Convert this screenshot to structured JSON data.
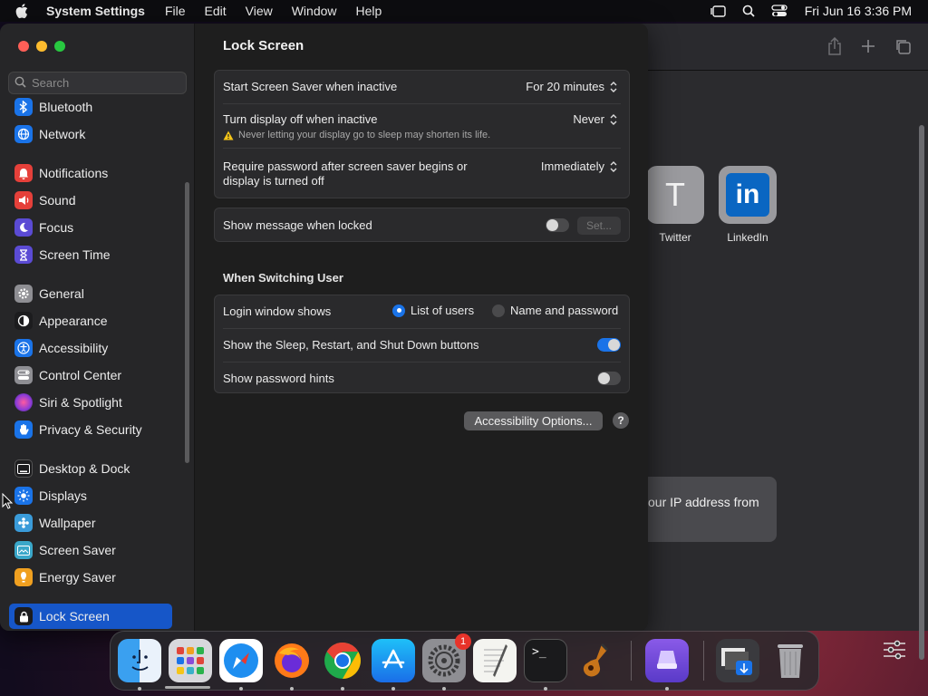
{
  "menubar": {
    "app_name": "System Settings",
    "menus": [
      "File",
      "Edit",
      "View",
      "Window",
      "Help"
    ],
    "clock": "Fri Jun 16  3:36 PM"
  },
  "search": {
    "placeholder": "Search"
  },
  "sidebar": {
    "items": [
      {
        "label": "Bluetooth",
        "icon": "bluetooth-icon",
        "color": "#1a73e8"
      },
      {
        "label": "Network",
        "icon": "network-globe-icon",
        "color": "#1a73e8"
      },
      {
        "label": "Notifications",
        "icon": "bell-icon",
        "color": "#e5403a"
      },
      {
        "label": "Sound",
        "icon": "speaker-icon",
        "color": "#e5403a"
      },
      {
        "label": "Focus",
        "icon": "moon-icon",
        "color": "#5b4bd4"
      },
      {
        "label": "Screen Time",
        "icon": "hourglass-icon",
        "color": "#5b4bd4"
      },
      {
        "label": "General",
        "icon": "gear-icon",
        "color": "#8e8e93"
      },
      {
        "label": "Appearance",
        "icon": "appearance-icon",
        "color": "#1c1c1e"
      },
      {
        "label": "Accessibility",
        "icon": "accessibility-icon",
        "color": "#1a73e8"
      },
      {
        "label": "Control Center",
        "icon": "control-center-icon",
        "color": "#8e8e93"
      },
      {
        "label": "Siri & Spotlight",
        "icon": "siri-icon",
        "color": "#c44bd4"
      },
      {
        "label": "Privacy & Security",
        "icon": "hand-icon",
        "color": "#1a73e8"
      },
      {
        "label": "Desktop & Dock",
        "icon": "dock-icon",
        "color": "#1c1c1e"
      },
      {
        "label": "Displays",
        "icon": "sun-icon",
        "color": "#1a73e8"
      },
      {
        "label": "Wallpaper",
        "icon": "wallpaper-icon",
        "color": "#3a9bd9"
      },
      {
        "label": "Screen Saver",
        "icon": "screen-saver-icon",
        "color": "#3aa7c9"
      },
      {
        "label": "Energy Saver",
        "icon": "battery-icon",
        "color": "#f0a020"
      },
      {
        "label": "Lock Screen",
        "icon": "lock-icon",
        "color": "#1c1c1e"
      }
    ]
  },
  "main": {
    "title": "Lock Screen",
    "rows": {
      "screen_saver": {
        "label": "Start Screen Saver when inactive",
        "value": "For 20 minutes"
      },
      "display_off": {
        "label": "Turn display off when inactive",
        "value": "Never",
        "warning": "Never letting your display go to sleep may shorten its life."
      },
      "require_password": {
        "label": "Require password after screen saver begins or display is turned off",
        "value": "Immediately"
      },
      "show_message": {
        "label": "Show message when locked",
        "button": "Set..."
      }
    },
    "switching": {
      "heading": "When Switching User",
      "login_window": {
        "label": "Login window shows",
        "options": [
          "List of users",
          "Name and password"
        ],
        "selected": "List of users"
      },
      "sleep_buttons": {
        "label": "Show the Sleep, Restart, and Shut Down buttons"
      },
      "password_hints": {
        "label": "Show password hints"
      }
    },
    "accessibility_button": "Accessibility Options...",
    "help": "?"
  },
  "browser": {
    "favorites": [
      {
        "label": "Twitter",
        "letter": "T"
      },
      {
        "label": "LinkedIn",
        "letter": "in"
      }
    ],
    "card_text": "our IP address from"
  },
  "dock": {
    "apps": [
      "Finder",
      "Launchpad",
      "Safari",
      "Firefox",
      "Chrome",
      "App Store",
      "System Settings",
      "TextEdit",
      "Terminal",
      "GarageBand",
      "Apple Configurator",
      "Downloads",
      "Trash"
    ],
    "settings_badge": "1"
  },
  "colors": {
    "accent": "#1a73e8",
    "selection": "#1656c8"
  }
}
